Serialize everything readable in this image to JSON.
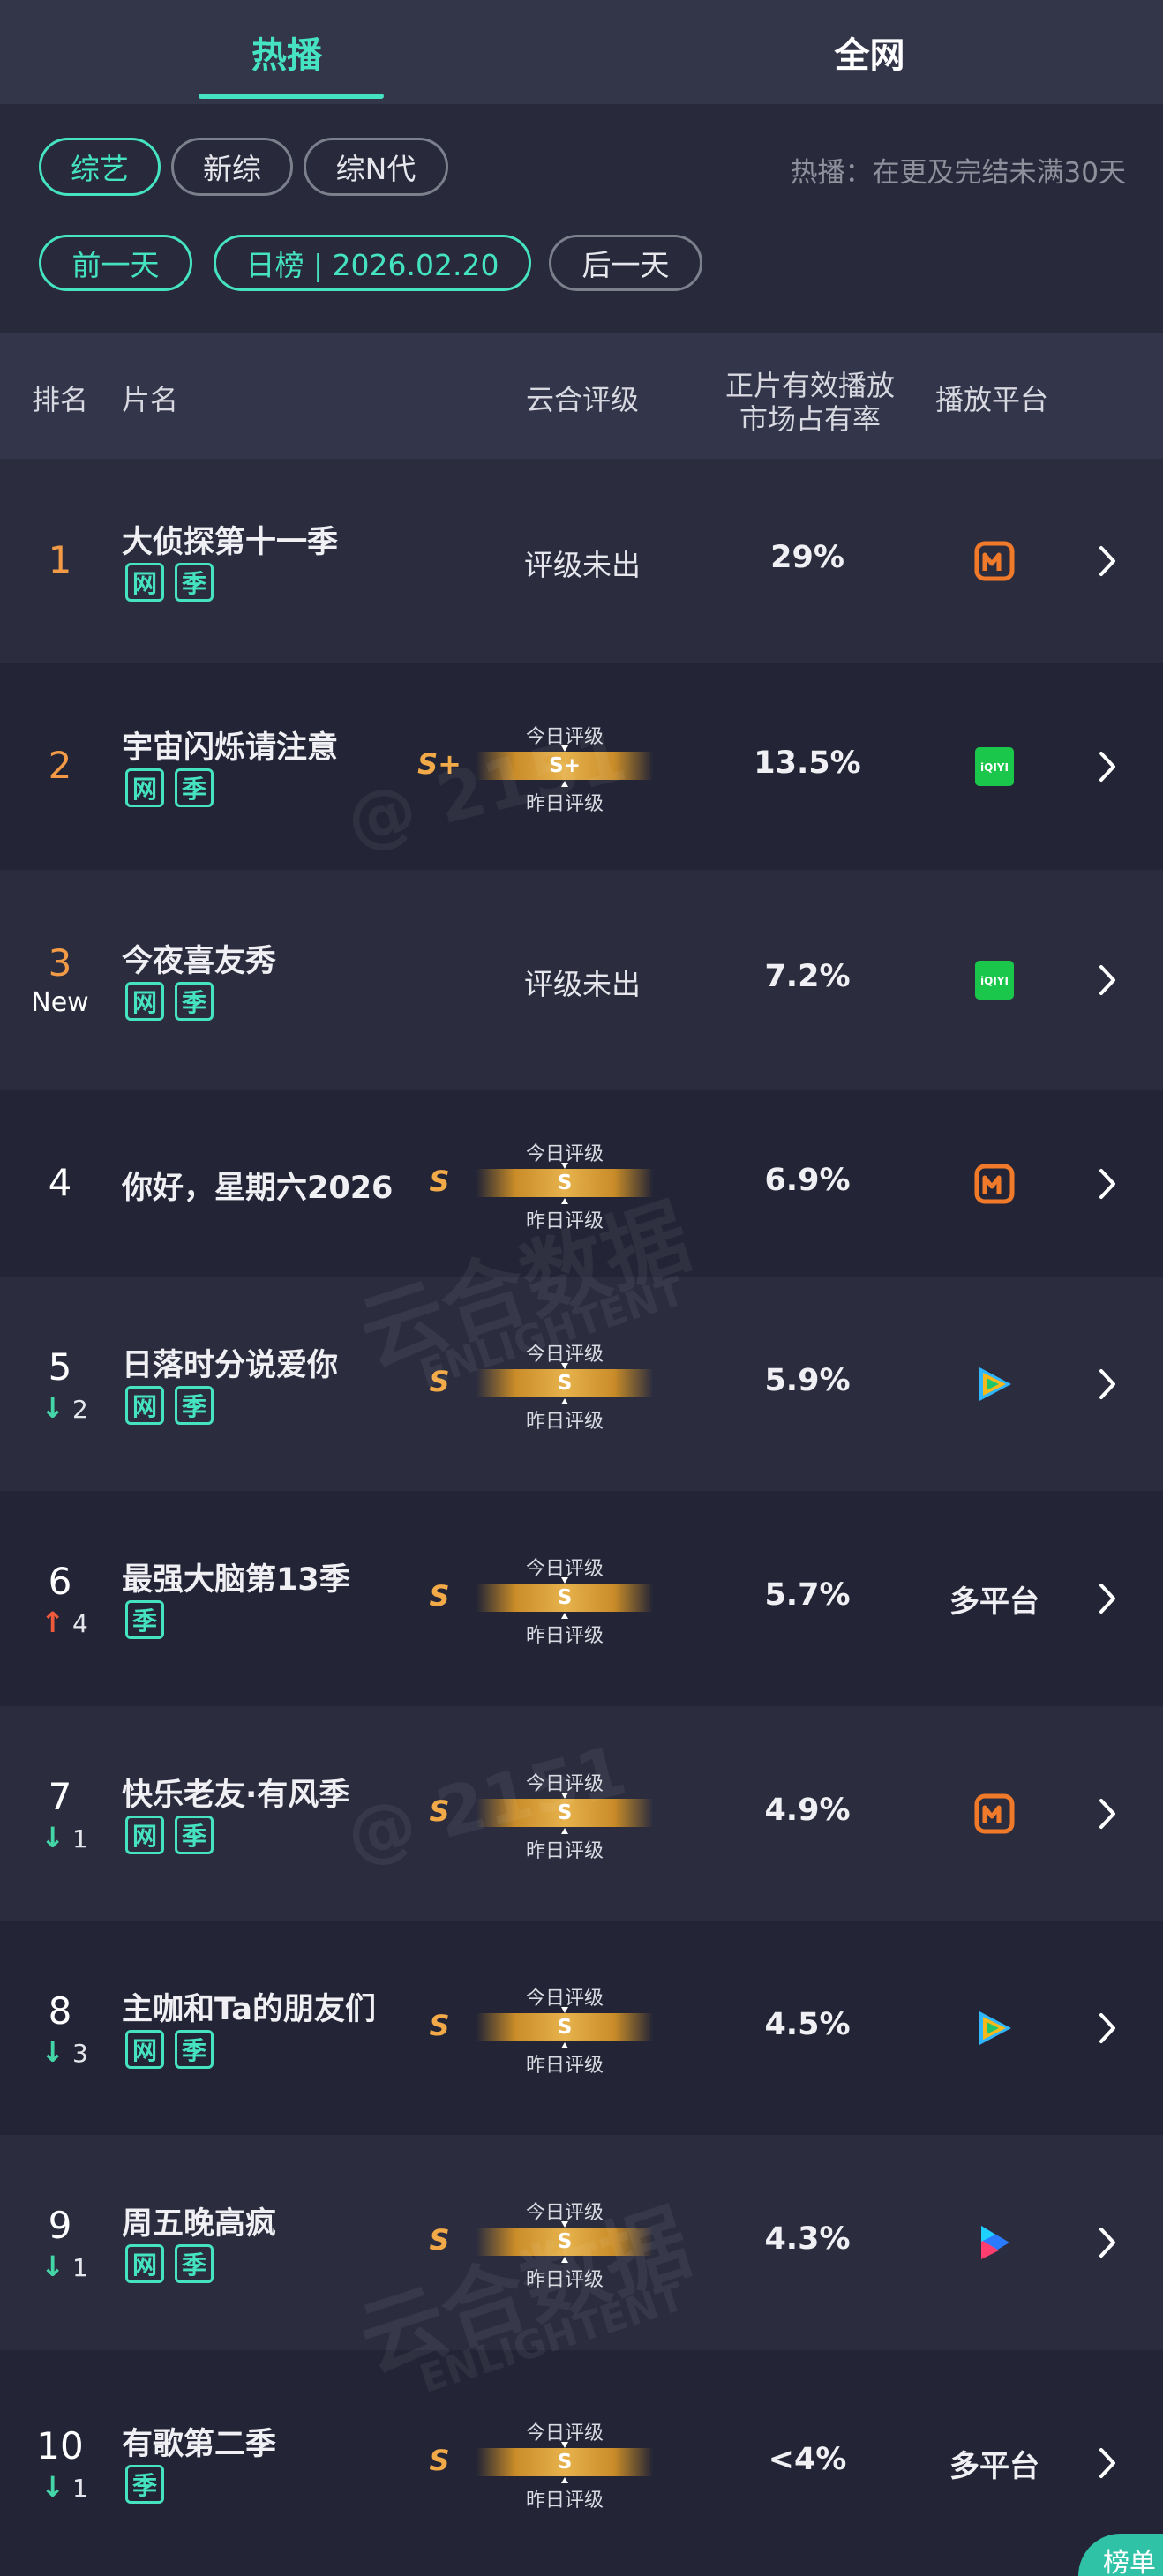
{
  "tabs": {
    "hot": "热播",
    "all": "全网"
  },
  "filters": {
    "categories": [
      "综艺",
      "新综",
      "综N代"
    ],
    "hint": "热播：在更及完结未满30天",
    "prev_day": "前一天",
    "date": "日榜 | 2026.02.20",
    "next_day": "后一天"
  },
  "header": {
    "rank": "排名",
    "title": "片名",
    "grade": "云合评级",
    "share_line1": "正片有效播放",
    "share_line2": "市场占有率",
    "platform": "播放平台"
  },
  "labels": {
    "today": "今日评级",
    "yesterday": "昨日评级",
    "no_grade": "评级未出",
    "new": "New",
    "multi": "多平台"
  },
  "tag_names": {
    "net": "网",
    "season": "季"
  },
  "rows": [
    {
      "rank": "1",
      "title": "大侦探第十一季",
      "tags": [
        "网",
        "季"
      ],
      "grade": "",
      "share": "29%",
      "platform": "mango-icon"
    },
    {
      "rank": "2",
      "title": "宇宙闪烁请注意",
      "tags": [
        "网",
        "季"
      ],
      "grade": "S+",
      "share": "13.5%",
      "platform": "iqiyi-icon"
    },
    {
      "rank": "3",
      "title": "今夜喜友秀",
      "tags": [
        "网",
        "季"
      ],
      "grade": "",
      "share": "7.2%",
      "platform": "iqiyi-icon",
      "new": true
    },
    {
      "rank": "4",
      "title": "你好，星期六2026",
      "tags": [],
      "grade": "S",
      "share": "6.9%",
      "platform": "mango-icon"
    },
    {
      "rank": "5",
      "title": "日落时分说爱你",
      "tags": [
        "网",
        "季"
      ],
      "grade": "S",
      "share": "5.9%",
      "platform": "tencent-video-icon",
      "delta": "2",
      "dir": "down"
    },
    {
      "rank": "6",
      "title": "最强大脑第13季",
      "tags": [
        "季"
      ],
      "grade": "S",
      "share": "5.7%",
      "platform": "多平台",
      "delta": "4",
      "dir": "up"
    },
    {
      "rank": "7",
      "title": "快乐老友·有风季",
      "tags": [
        "网",
        "季"
      ],
      "grade": "S",
      "share": "4.9%",
      "platform": "mango-icon",
      "delta": "1",
      "dir": "down"
    },
    {
      "rank": "8",
      "title": "主咖和Ta的朋友们",
      "tags": [
        "网",
        "季"
      ],
      "grade": "S",
      "share": "4.5%",
      "platform": "tencent-video-icon",
      "delta": "3",
      "dir": "down"
    },
    {
      "rank": "9",
      "title": "周五晚高疯",
      "tags": [
        "网",
        "季"
      ],
      "grade": "S",
      "share": "4.3%",
      "platform": "youku-icon",
      "delta": "1",
      "dir": "down"
    },
    {
      "rank": "10",
      "title": "有歌第二季",
      "tags": [
        "季"
      ],
      "grade": "S",
      "share": "<4%",
      "platform": "多平台",
      "delta": "1",
      "dir": "down"
    }
  ],
  "watermarks": {
    "handle": "@ 2151",
    "brand": "云合数据",
    "brand_en": "ENLIGHTENT"
  },
  "fab": "榜单"
}
